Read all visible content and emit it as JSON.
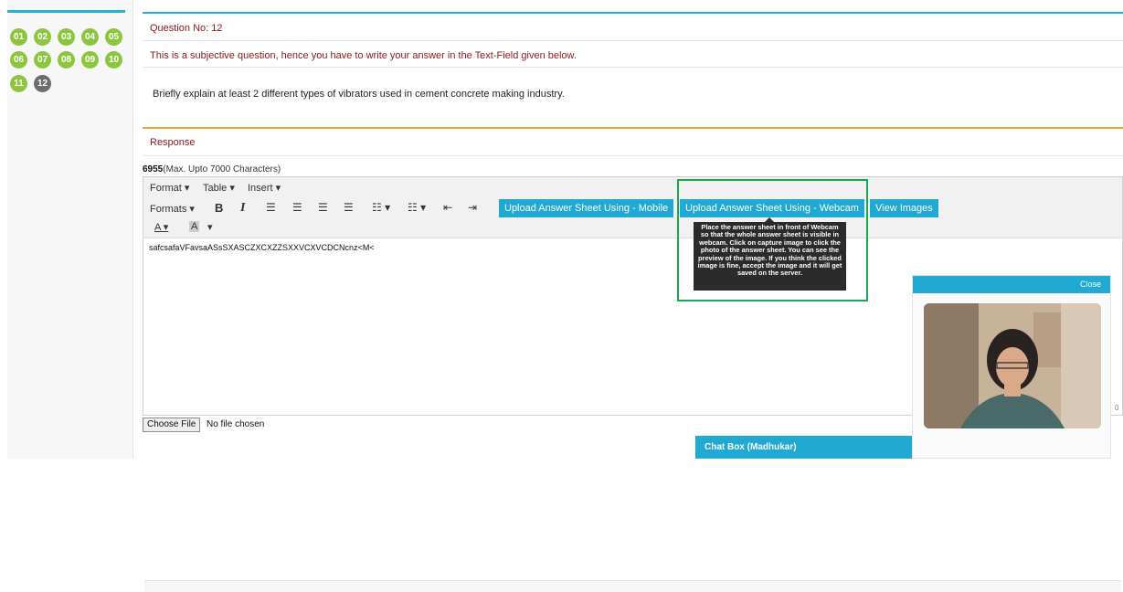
{
  "palette": {
    "questions": [
      {
        "label": "01",
        "state": "answered"
      },
      {
        "label": "02",
        "state": "answered"
      },
      {
        "label": "03",
        "state": "answered"
      },
      {
        "label": "04",
        "state": "answered"
      },
      {
        "label": "05",
        "state": "answered"
      },
      {
        "label": "06",
        "state": "answered"
      },
      {
        "label": "07",
        "state": "answered"
      },
      {
        "label": "08",
        "state": "answered"
      },
      {
        "label": "09",
        "state": "answered"
      },
      {
        "label": "10",
        "state": "answered"
      },
      {
        "label": "11",
        "state": "answered"
      },
      {
        "label": "12",
        "state": "current"
      }
    ]
  },
  "question": {
    "number_label": "Question No: 12",
    "info": "This is a subjective question, hence you have to write your answer in the Text-Field given below.",
    "text": "Briefly explain at least 2 different types of vibrators used in cement concrete making industry."
  },
  "response": {
    "heading": "Response",
    "char_count": "6955",
    "char_limit_text": "(Max. Upto 7000 Characters)"
  },
  "editor": {
    "menus": [
      "Format ▾",
      "Table ▾",
      "Insert ▾"
    ],
    "formats_label": "Formats ▾",
    "upload_mobile": "Upload Answer Sheet Using - Mobile",
    "upload_webcam": "Upload Answer Sheet Using - Webcam",
    "view_images": "View Images",
    "content": "safcsafaVFavsaASsSXASCZXCXZZSXXVCXVCDCNcnz<M<",
    "tooltip": "Place the answer sheet in front of Webcam so that the whole answer sheet is visible in webcam. Click on capture image to click the photo of the answer sheet. You can see the preview of the image. If you think the clicked image is fine, accept the image and it will get saved on the server.",
    "edge_number": "0"
  },
  "file": {
    "choose_label": "Choose File",
    "status": "No file chosen"
  },
  "chat": {
    "title": "Chat Box (Madhukar)"
  },
  "webcam": {
    "close_label": "Close"
  },
  "colors": {
    "accent": "#1fa9d3",
    "answered": "#8cc63f",
    "current": "#6d6d6d",
    "highlight": "#1aa84d",
    "question_text": "#8b1a1a"
  }
}
